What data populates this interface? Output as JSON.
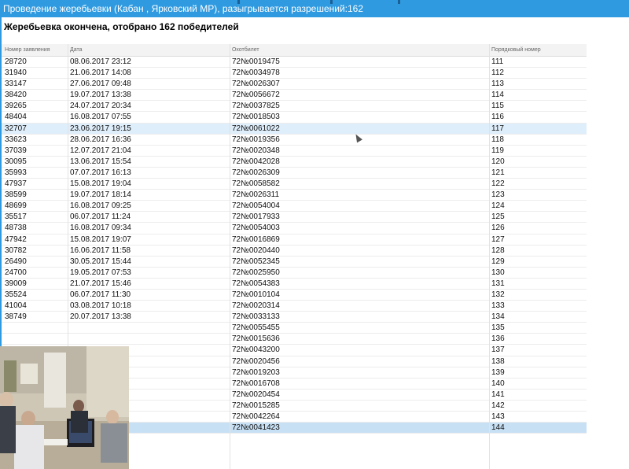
{
  "window": {
    "title": "Проведение жеребьевки (Кабан , Ярковский МР), разыгрывается разрешений:162"
  },
  "status": "Жеребьевка окончена, отобрано 162 победителей",
  "table": {
    "columns": [
      "Номер заявления",
      "Дата",
      "Охотбилет",
      "Порядковый номер"
    ],
    "rows": [
      [
        "28720",
        "08.06.2017 23:12",
        "72№0019475",
        "111"
      ],
      [
        "31940",
        "21.06.2017 14:08",
        "72№0034978",
        "112"
      ],
      [
        "33147",
        "27.06.2017 09:48",
        "72№0026307",
        "113"
      ],
      [
        "38420",
        "19.07.2017 13:38",
        "72№0056672",
        "114"
      ],
      [
        "39265",
        "24.07.2017 20:34",
        "72№0037825",
        "115"
      ],
      [
        "48404",
        "16.08.2017 07:55",
        "72№0018503",
        "116"
      ],
      [
        "32707",
        "23.06.2017 19:15",
        "72№0061022",
        "117"
      ],
      [
        "33623",
        "28.06.2017 16:36",
        "72№0019356",
        "118"
      ],
      [
        "37039",
        "12.07.2017 21:04",
        "72№0020348",
        "119"
      ],
      [
        "30095",
        "13.06.2017 15:54",
        "72№0042028",
        "120"
      ],
      [
        "35993",
        "07.07.2017 16:13",
        "72№0026309",
        "121"
      ],
      [
        "47937",
        "15.08.2017 19:04",
        "72№0058582",
        "122"
      ],
      [
        "38599",
        "19.07.2017 18:14",
        "72№0026311",
        "123"
      ],
      [
        "48699",
        "16.08.2017 09:25",
        "72№0054004",
        "124"
      ],
      [
        "35517",
        "06.07.2017 11:24",
        "72№0017933",
        "125"
      ],
      [
        "48738",
        "16.08.2017 09:34",
        "72№0054003",
        "126"
      ],
      [
        "47942",
        "15.08.2017 19:07",
        "72№0016869",
        "127"
      ],
      [
        "30782",
        "16.06.2017 11:58",
        "72№0020440",
        "128"
      ],
      [
        "26490",
        "30.05.2017 15:44",
        "72№0052345",
        "129"
      ],
      [
        "24700",
        "19.05.2017 07:53",
        "72№0025950",
        "130"
      ],
      [
        "39009",
        "21.07.2017 15:46",
        "72№0054383",
        "131"
      ],
      [
        "35524",
        "06.07.2017 11:30",
        "72№0010104",
        "132"
      ],
      [
        "41004",
        "03.08.2017 10:18",
        "72№0020314",
        "133"
      ],
      [
        "38749",
        "20.07.2017 13:38",
        "72№0033133",
        "134"
      ],
      [
        "",
        "",
        "72№0055455",
        "135"
      ],
      [
        "",
        "",
        "72№0015636",
        "136"
      ],
      [
        "",
        "",
        "72№0043200",
        "137"
      ],
      [
        "",
        "",
        "72№0020456",
        "138"
      ],
      [
        "",
        "",
        "72№0019203",
        "139"
      ],
      [
        "",
        "",
        "72№0016708",
        "140"
      ],
      [
        "",
        "",
        "72№0020454",
        "141"
      ],
      [
        "",
        "",
        "72№0015285",
        "142"
      ],
      [
        "",
        "",
        "72№0042264",
        "143"
      ],
      [
        "",
        "",
        "72№0041423",
        "144"
      ]
    ],
    "highlighted_row_index": 6,
    "selected_row_index": 33
  }
}
